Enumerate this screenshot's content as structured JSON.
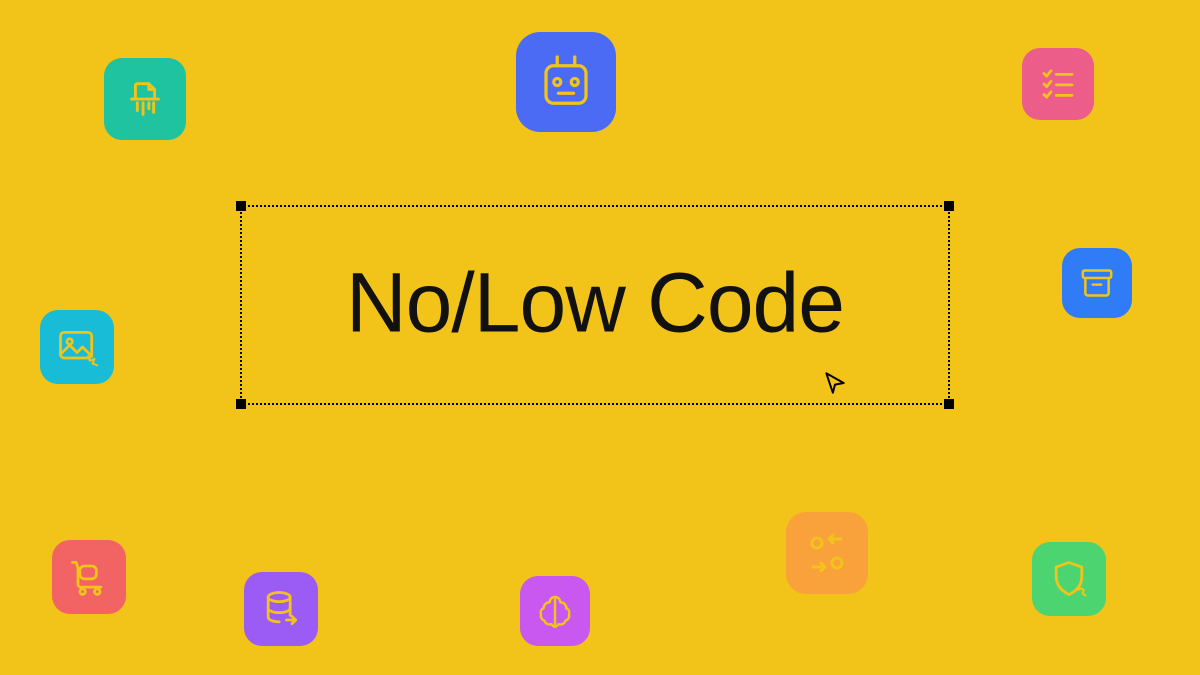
{
  "title": "No/Low Code",
  "colors": {
    "bg": "#f2c318",
    "teal": "#20c3a0",
    "blue": "#4b6bf5",
    "pink": "#ed5d8a",
    "cyan": "#18bcd6",
    "royal": "#2f7cf6",
    "coral": "#f26464",
    "purple": "#9b5cf6",
    "magenta": "#c858f0",
    "orange": "#f9a23c",
    "green": "#4cd471"
  },
  "icons": {
    "shredder": "shredder-icon",
    "robot": "robot-icon",
    "checklist": "checklist-icon",
    "image": "image-icon",
    "archive": "archive-icon",
    "cart": "cart-icon",
    "database": "database-icon",
    "brain": "brain-icon",
    "transfer": "transfer-icon",
    "shield": "shield-icon"
  }
}
